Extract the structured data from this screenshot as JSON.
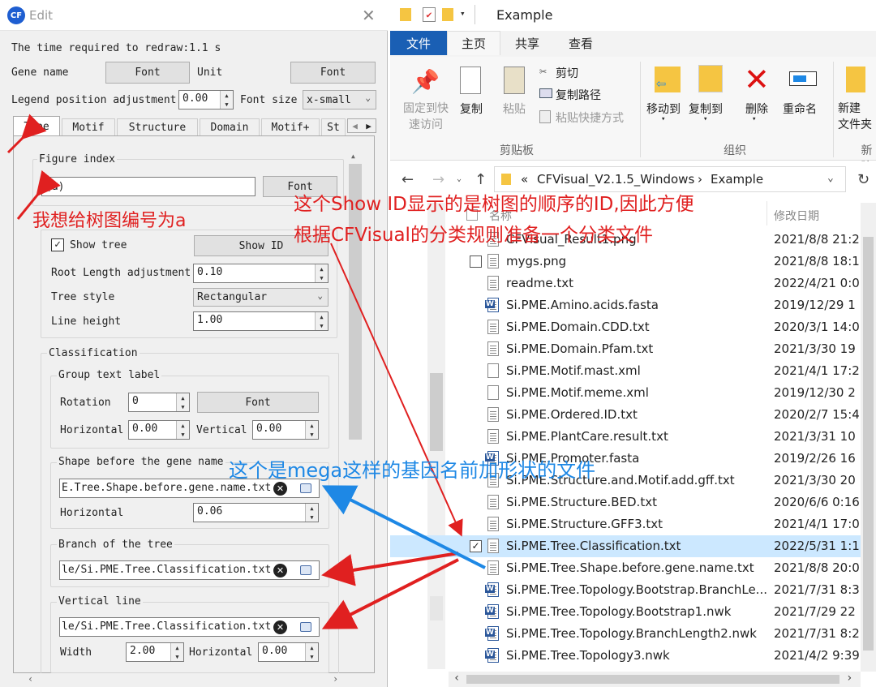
{
  "edit_window": {
    "logo": "CF",
    "title": "Edit",
    "redraw_time": "The time required to redraw:1.1 s",
    "gene_name_label": "Gene name",
    "font_button": "Font",
    "unit_label": "Unit",
    "legend_position_label": "Legend position adjustment",
    "legend_position_value": "0.00",
    "font_size_label": "Font size",
    "font_size_value": "x-small",
    "tabs": [
      "Tree",
      "Motif",
      "Structure",
      "Domain",
      "Motif+",
      "St"
    ],
    "figure_index": {
      "title": "Figure index",
      "value": "(a)",
      "font_button": "Font"
    },
    "show_tree_label": "Show tree",
    "show_id_button": "Show ID",
    "root_length_label": "Root Length adjustment",
    "root_length_value": "0.10",
    "tree_style_label": "Tree style",
    "tree_style_value": "Rectangular",
    "line_height_label": "Line height",
    "line_height_value": "1.00",
    "classification": {
      "title": "Classification",
      "group_text_label": "Group text label",
      "rotation_label": "Rotation",
      "rotation_value": "0",
      "font_button": "Font",
      "horizontal_label": "Horizontal",
      "horizontal_value": "0.00",
      "vertical_label": "Vertical",
      "vertical_value": "0.00",
      "shape_title": "Shape before the gene name",
      "shape_file": "E.Tree.Shape.before.gene.name.txt",
      "shape_horizontal_label": "Horizontal",
      "shape_horizontal_value": "0.06",
      "branch_title": "Branch of the tree",
      "branch_file": "le/Si.PME.Tree.Classification.txt",
      "vline_title": "Vertical line",
      "vline_file": "le/Si.PME.Tree.Classification.txt",
      "width_label": "Width",
      "width_value": "2.00",
      "vline_horizontal_label": "Horizontal",
      "vline_horizontal_value": "0.00"
    }
  },
  "explorer": {
    "title": "Example",
    "ribbon_tabs": [
      "文件",
      "主页",
      "共享",
      "查看"
    ],
    "clipboard": {
      "pin": "固定到快\n速访问",
      "copy": "复制",
      "paste": "粘贴",
      "cut": "剪切",
      "copy_path": "复制路径",
      "paste_shortcut": "粘贴快捷方式",
      "section": "剪贴板"
    },
    "organize": {
      "move_to": "移动到",
      "copy_to": "复制到",
      "delete": "删除",
      "rename": "重命名",
      "section": "组织"
    },
    "new": {
      "new_folder": "新建\n文件夹",
      "section": "新建"
    },
    "path": [
      "«",
      "CFVisual_V2.1.5_Windows",
      "›",
      "Example"
    ],
    "columns": {
      "name": "名称",
      "date": "修改日期"
    },
    "files": [
      {
        "name": "CFVisual_Result1.png",
        "date": "2021/8/8 21:2"
      },
      {
        "name": "mygs.png",
        "date": "2021/8/8 18:1"
      },
      {
        "name": "readme.txt",
        "date": "2022/4/21 0:0"
      },
      {
        "name": "Si.PME.Amino.acids.fasta",
        "date": "2019/12/29 1"
      },
      {
        "name": "Si.PME.Domain.CDD.txt",
        "date": "2020/3/1 14:0"
      },
      {
        "name": "Si.PME.Domain.Pfam.txt",
        "date": "2021/3/30 19"
      },
      {
        "name": "Si.PME.Motif.mast.xml",
        "date": "2021/4/1 17:2"
      },
      {
        "name": "Si.PME.Motif.meme.xml",
        "date": "2019/12/30 2"
      },
      {
        "name": "Si.PME.Ordered.ID.txt",
        "date": "2020/2/7 15:4"
      },
      {
        "name": "Si.PME.PlantCare.result.txt",
        "date": "2021/3/31 10"
      },
      {
        "name": "Si.PME.Promoter.fasta",
        "date": "2019/2/26 16"
      },
      {
        "name": "Si.PME.Structure.and.Motif.add.gff.txt",
        "date": "2021/3/30 20"
      },
      {
        "name": "Si.PME.Structure.BED.txt",
        "date": "2020/6/6 0:16"
      },
      {
        "name": "Si.PME.Structure.GFF3.txt",
        "date": "2021/4/1 17:0"
      },
      {
        "name": "Si.PME.Tree.Classification.txt",
        "date": "2022/5/31 1:1"
      },
      {
        "name": "Si.PME.Tree.Shape.before.gene.name.txt",
        "date": "2021/8/8 20:0"
      },
      {
        "name": "Si.PME.Tree.Topology.Bootstrap.BranchLe...",
        "date": "2021/7/31 8:3"
      },
      {
        "name": "Si.PME.Tree.Topology.Bootstrap1.nwk",
        "date": "2021/7/29 22"
      },
      {
        "name": "Si.PME.Tree.Topology.BranchLength2.nwk",
        "date": "2021/7/31 8:2"
      },
      {
        "name": "Si.PME.Tree.Topology3.nwk",
        "date": "2021/4/2 9:39"
      }
    ]
  },
  "annotations": {
    "figure_index_note": "我想给树图编号为a",
    "show_id_note_1": "这个Show ID显示的是树图的顺序的ID,因此方便",
    "show_id_note_2": "根据CFVisual的分类规则准备一个分类文件",
    "shape_note": "这个是mega这样的基因名前加形状的文件"
  },
  "colors": {
    "annotation_red": "#e02020",
    "annotation_blue": "#1e88e5",
    "selection": "#cce8ff",
    "ribbon_file_tab": "#1a5fb4"
  }
}
